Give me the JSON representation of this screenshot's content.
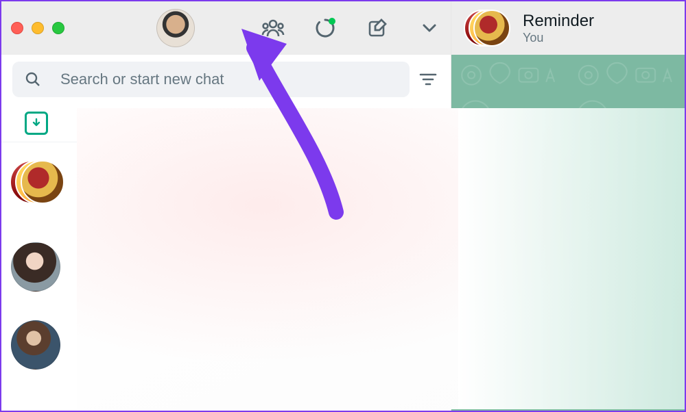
{
  "left": {
    "search_placeholder": "Search or start new chat"
  },
  "right": {
    "title": "Reminder",
    "subtitle": "You"
  },
  "annotation": {
    "arrow_color": "#7c3aed",
    "arrow_target": "communities-icon"
  }
}
